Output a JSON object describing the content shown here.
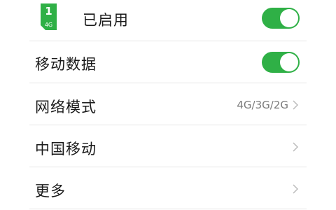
{
  "colors": {
    "accent": "#2fb046",
    "text_primary": "#1a1a1a",
    "text_secondary": "#7a7a7a",
    "divider": "#e6e6e6",
    "chevron": "#b8b8b8"
  },
  "sim": {
    "slot_number": "1",
    "network_type": "4G",
    "icon": "sim-card-icon",
    "status_label": "已启用",
    "enabled": true
  },
  "mobile_data": {
    "label": "移动数据",
    "enabled": true
  },
  "network_mode": {
    "label": "网络模式",
    "value": "4G/3G/2G",
    "icon": "chevron-right-icon"
  },
  "carrier": {
    "label": "中国移动",
    "icon": "chevron-right-icon"
  },
  "more": {
    "label": "更多",
    "icon": "chevron-right-icon"
  }
}
